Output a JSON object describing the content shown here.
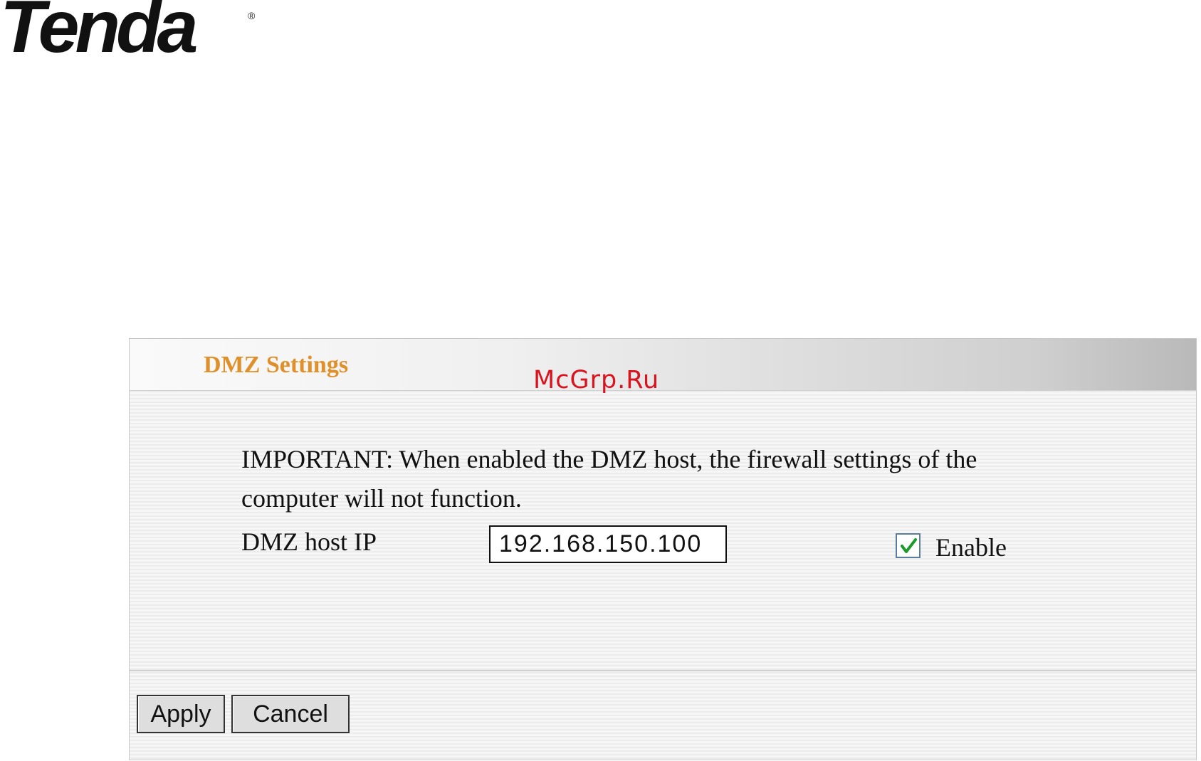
{
  "logo": {
    "text": "Tenda",
    "registered": "®"
  },
  "watermark": "McGrp.Ru",
  "panel": {
    "title": "DMZ Settings",
    "important_text": "IMPORTANT: When enabled the DMZ host, the firewall settings of the computer will not function.",
    "host_label": "DMZ host IP",
    "host_ip_value": "192.168.150.100",
    "enable_label": "Enable",
    "enable_checked": true
  },
  "buttons": {
    "apply": "Apply",
    "cancel": "Cancel"
  },
  "colors": {
    "title": "#e0902a",
    "watermark": "#d9141f",
    "check": "#1a9a2a"
  }
}
